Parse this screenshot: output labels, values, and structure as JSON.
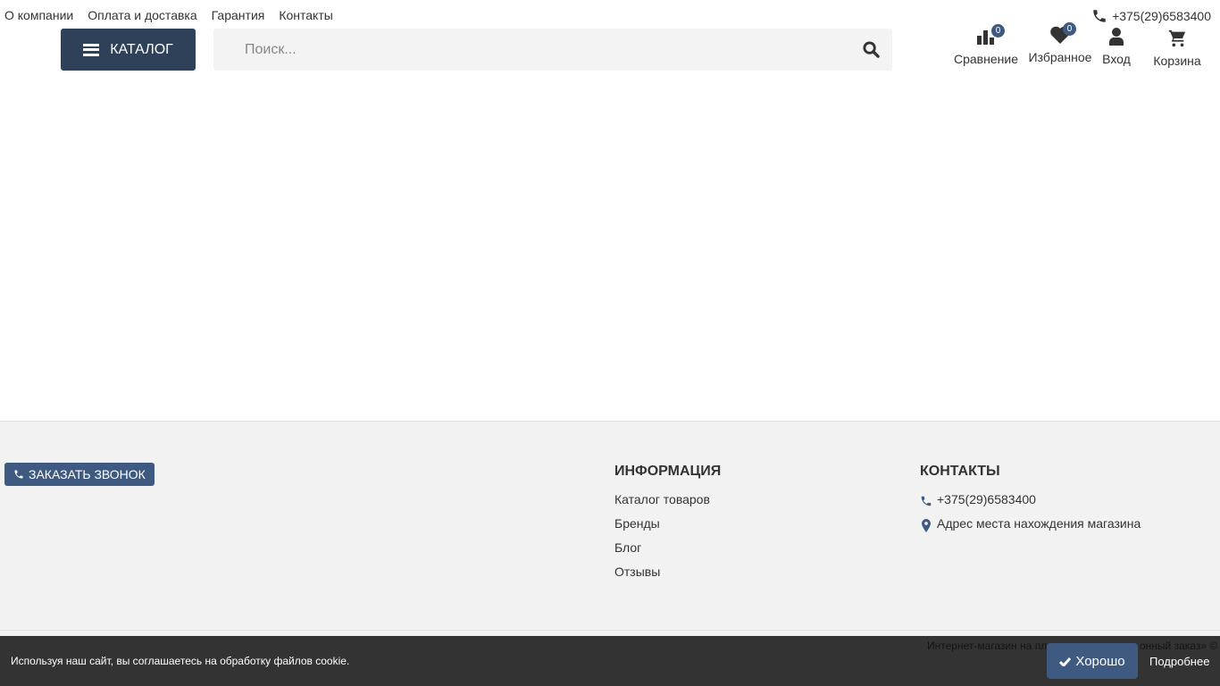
{
  "topnav": [
    "О компании",
    "Оплата и доставка",
    "Гарантия",
    "Контакты"
  ],
  "header": {
    "phone": "+375(29)6583400",
    "catalog_label": "КАТАЛОГ",
    "search_placeholder": "Поиск...",
    "icons": [
      {
        "label": "Сравнение",
        "badge": "0",
        "icon": "bar-chart-icon"
      },
      {
        "label": "Избранное",
        "badge": "0",
        "icon": "heart-icon"
      },
      {
        "label": "Вход",
        "icon": "user-icon"
      },
      {
        "label": "Корзина",
        "icon": "cart-icon"
      }
    ]
  },
  "footer": {
    "callback_label": "ЗАКАЗАТЬ ЗВОНОК",
    "info": {
      "title": "ИНФОРМАЦИЯ",
      "links": [
        "Каталог товаров",
        "Бренды",
        "Блог",
        "Отзывы"
      ]
    },
    "contacts": {
      "title": "КОНТАКТЫ",
      "phone": "+375(29)6583400",
      "address": "Адрес места нахождения магазина"
    },
    "copyright_left": "Интернет-магазин на пл",
    "copyright_right": "онный заказ» ©"
  },
  "cookie": {
    "message": "Используя наш сайт, вы соглашаетесь на обработку файлов cookie.",
    "ok_label": "Хорошо",
    "more_label": "Подробнее"
  },
  "colors": {
    "accent": "#3f5a80",
    "catalog_bg": "#2f4059",
    "cookie_bg": "#2f2f2f"
  }
}
